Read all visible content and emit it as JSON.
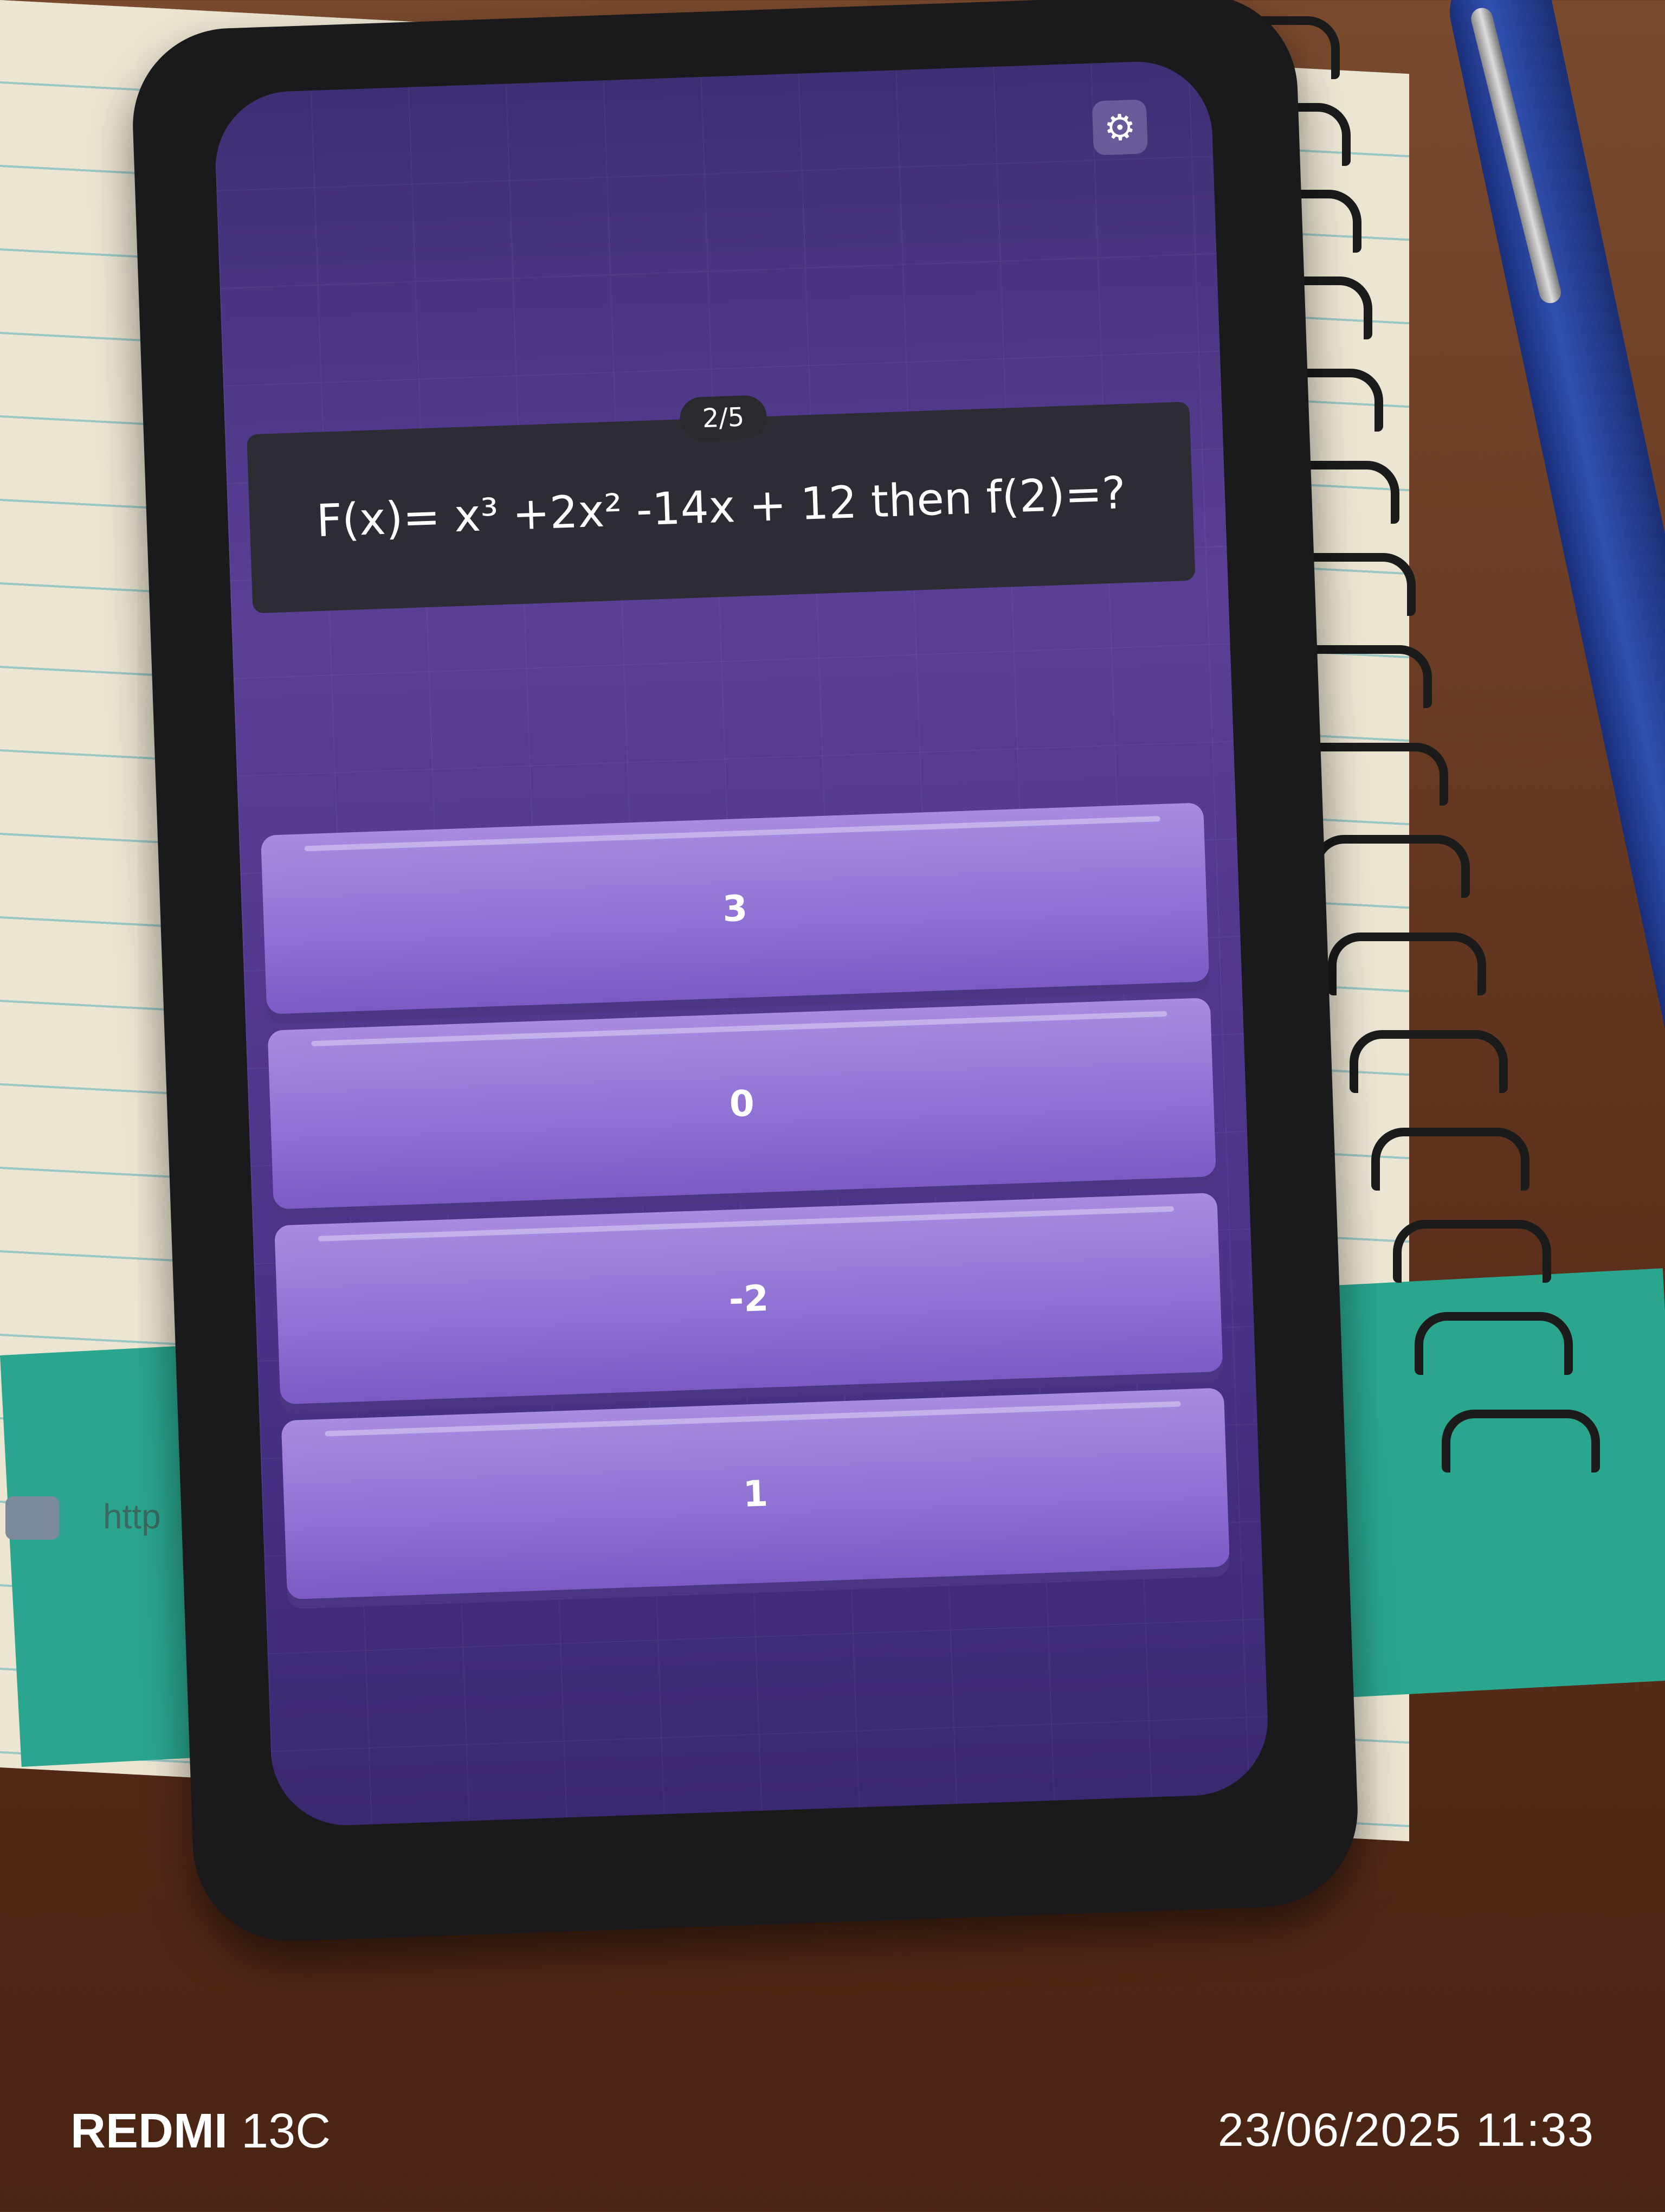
{
  "quiz": {
    "progress": "2/5",
    "question": "F(x)= x³ +2x² -14x + 12 then f(2)=?",
    "answers": [
      "3",
      "0",
      "-2",
      "1"
    ]
  },
  "icons": {
    "settings": "gear-icon"
  },
  "background": {
    "link_text": "http"
  },
  "watermark": {
    "brand": "REDMI",
    "model": "13C",
    "datetime": "23/06/2025 11:33"
  }
}
